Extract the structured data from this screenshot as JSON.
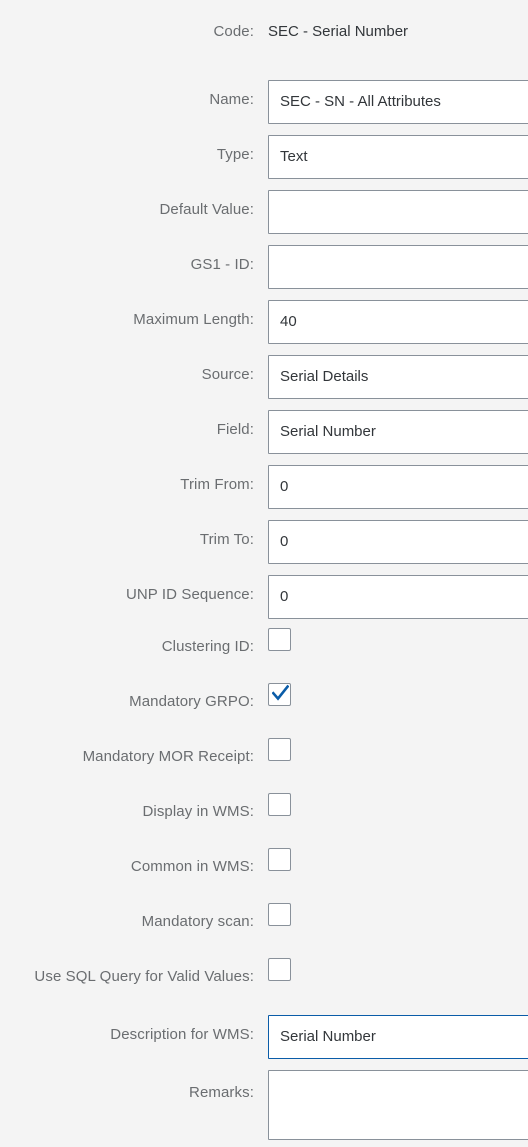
{
  "form": {
    "colors": {
      "background": "#f4f4f4",
      "label": "#6a6d70",
      "value": "#32363a",
      "field_border": "#89919a",
      "focus_border": "#0a5ca8",
      "checkbox_tick": "#0a5ca8"
    },
    "rows": [
      {
        "label": "Code:",
        "kind": "static",
        "value": "SEC - Serial Number"
      },
      {
        "label": "Name:",
        "kind": "input",
        "value": "SEC - SN - All Attributes",
        "focused": false
      },
      {
        "label": "Type:",
        "kind": "input",
        "value": "Text",
        "focused": false
      },
      {
        "label": "Default Value:",
        "kind": "input",
        "value": "",
        "focused": false
      },
      {
        "label": "GS1 - ID:",
        "kind": "input",
        "value": "",
        "focused": false
      },
      {
        "label": "Maximum Length:",
        "kind": "input",
        "value": "40",
        "focused": false
      },
      {
        "label": "Source:",
        "kind": "input",
        "value": "Serial Details",
        "focused": false
      },
      {
        "label": "Field:",
        "kind": "input",
        "value": "Serial Number",
        "focused": false
      },
      {
        "label": "Trim From:",
        "kind": "input",
        "value": "0",
        "focused": false
      },
      {
        "label": "Trim To:",
        "kind": "input",
        "value": "0",
        "focused": false
      },
      {
        "label": "UNP ID Sequence:",
        "kind": "input",
        "value": "0",
        "focused": false
      },
      {
        "label": "Clustering ID:",
        "kind": "checkbox",
        "checked": false
      },
      {
        "label": "Mandatory GRPO:",
        "kind": "checkbox",
        "checked": true
      },
      {
        "label": "Mandatory MOR Receipt:",
        "kind": "checkbox",
        "checked": false
      },
      {
        "label": "Display in WMS:",
        "kind": "checkbox",
        "checked": false
      },
      {
        "label": "Common in WMS:",
        "kind": "checkbox",
        "checked": false
      },
      {
        "label": "Mandatory scan:",
        "kind": "checkbox",
        "checked": false
      },
      {
        "label": "Use SQL Query for Valid Values:",
        "kind": "checkbox",
        "checked": false
      },
      {
        "label": "Description for WMS:",
        "kind": "input",
        "value": "Serial Number",
        "focused": true
      },
      {
        "label": "Remarks:",
        "kind": "textarea",
        "value": ""
      }
    ]
  }
}
